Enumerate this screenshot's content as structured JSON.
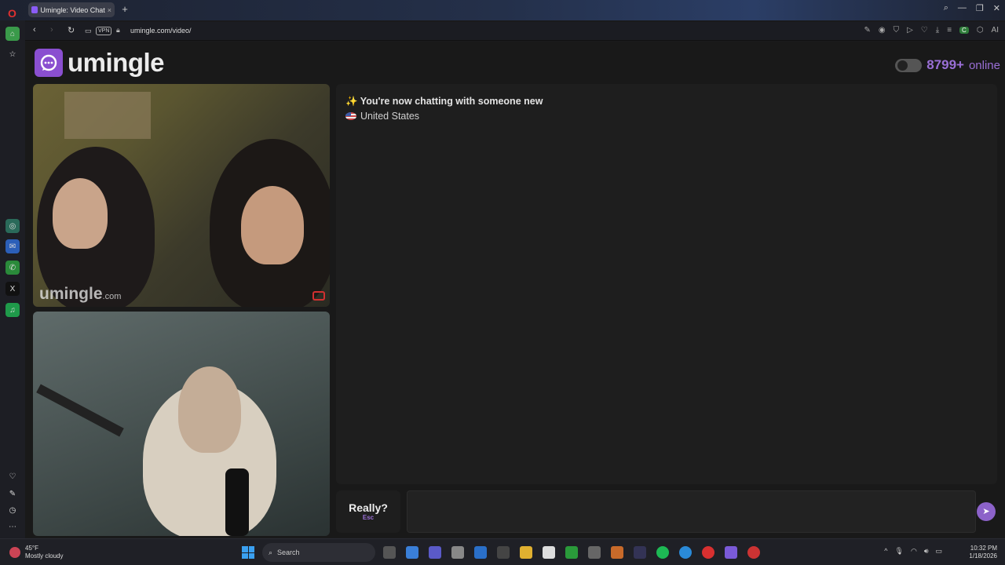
{
  "browser": {
    "tab_title": "Umingle: Video Chat",
    "url": "umingle.com/video/",
    "vpn_label": "VPN"
  },
  "header": {
    "brand": "umingle",
    "online_count": "8799+",
    "online_label": "online"
  },
  "video": {
    "watermark_main": "umingle",
    "watermark_suffix": ".com"
  },
  "chat": {
    "message": "✨ You're now chatting with someone new",
    "country": "United States",
    "esc_button_label": "Really?",
    "esc_button_hint": "Esc",
    "input_value": ""
  },
  "taskbar": {
    "temperature": "45°F",
    "weather": "Mostly cloudy",
    "search_placeholder": "Search",
    "time": "10:32 PM",
    "date": "1/18/2026"
  },
  "colors": {
    "accent": "#8a4fd0",
    "online_text": "#9a6fd6"
  }
}
